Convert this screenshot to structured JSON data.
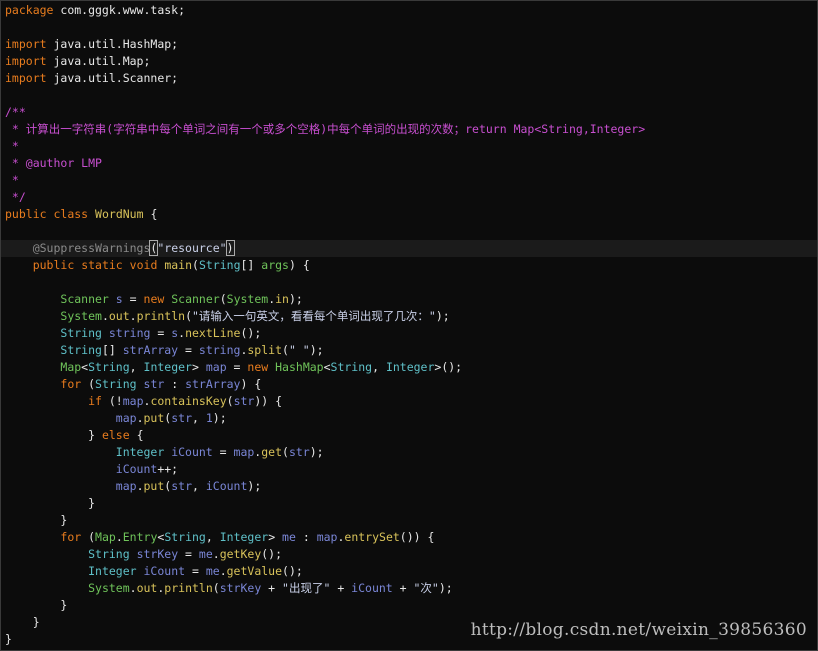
{
  "code": {
    "l01": [
      "package",
      " com.gggk.www.task;"
    ],
    "l03": [
      "import",
      " java.util.HashMap;"
    ],
    "l04": [
      "import",
      " java.util.Map;"
    ],
    "l05": [
      "import",
      " java.util.Scanner;"
    ],
    "l07": "/**",
    "l08": " * 计算出一字符串(字符串中每个单词之间有一个或多个空格)中每个单词的出现的次数；return Map<String,Integer>",
    "l09": " *",
    "l10": [
      " * ",
      "@author",
      " LMP"
    ],
    "l11": " *",
    "l12": " */",
    "l13": [
      "public",
      " ",
      "class",
      " ",
      "WordNum",
      " {"
    ],
    "l15": [
      "    ",
      "@SuppressWarnings",
      "(",
      "\"resource\"",
      ")"
    ],
    "l16": [
      "    ",
      "public",
      " ",
      "static",
      " ",
      "void",
      " ",
      "main",
      "(",
      "String",
      "[] ",
      "args",
      ") {"
    ],
    "l18": [
      "        ",
      "Scanner",
      " ",
      "s",
      " = ",
      "new",
      " ",
      "Scanner",
      "(",
      "System",
      ".",
      "in",
      ");"
    ],
    "l19": [
      "        ",
      "System",
      ".",
      "out",
      ".",
      "println",
      "(",
      "\"请输入一句英文，看看每个单词出现了几次：\"",
      ");"
    ],
    "l20": [
      "        ",
      "String",
      " ",
      "string",
      " = ",
      "s",
      ".",
      "nextLine",
      "();"
    ],
    "l21": [
      "        ",
      "String",
      "[] ",
      "strArray",
      " = ",
      "string",
      ".",
      "split",
      "(",
      "\" \"",
      ");"
    ],
    "l22": [
      "        ",
      "Map",
      "<",
      "String",
      ", ",
      "Integer",
      "> ",
      "map",
      " = ",
      "new",
      " ",
      "HashMap",
      "<",
      "String",
      ", ",
      "Integer",
      ">();"
    ],
    "l23": [
      "        ",
      "for",
      " (",
      "String",
      " ",
      "str",
      " : ",
      "strArray",
      ") {"
    ],
    "l24": [
      "            ",
      "if",
      " (!",
      "map",
      ".",
      "containsKey",
      "(",
      "str",
      ")) {"
    ],
    "l25": [
      "                ",
      "map",
      ".",
      "put",
      "(",
      "str",
      ", ",
      "1",
      ");"
    ],
    "l26": [
      "            ",
      "} ",
      "else",
      " {"
    ],
    "l27": [
      "                ",
      "Integer",
      " ",
      "iCount",
      " = ",
      "map",
      ".",
      "get",
      "(",
      "str",
      ");"
    ],
    "l28": [
      "                ",
      "iCount",
      "++;"
    ],
    "l29": [
      "                ",
      "map",
      ".",
      "put",
      "(",
      "str",
      ", ",
      "iCount",
      ");"
    ],
    "l30": "            }",
    "l31": "        }",
    "l32": [
      "        ",
      "for",
      " (",
      "Map",
      ".",
      "Entry",
      "<",
      "String",
      ", ",
      "Integer",
      "> ",
      "me",
      " : ",
      "map",
      ".",
      "entrySet",
      "()) {"
    ],
    "l33": [
      "            ",
      "String",
      " ",
      "strKey",
      " = ",
      "me",
      ".",
      "getKey",
      "();"
    ],
    "l34": [
      "            ",
      "Integer",
      " ",
      "iCount",
      " = ",
      "me",
      ".",
      "getValue",
      "();"
    ],
    "l35": [
      "            ",
      "System",
      ".",
      "out",
      ".",
      "println",
      "(",
      "strKey",
      " + ",
      "\"出现了\"",
      " + ",
      "iCount",
      " + ",
      "\"次\"",
      ");"
    ],
    "l36": "        }",
    "l37": "    }",
    "l38": "}"
  },
  "watermark": "http://blog.csdn.net/weixin_39856360",
  "colors": {
    "background": "#0c0c0c",
    "keyword": "#e87c1e",
    "type": "#6fc35a",
    "builtin_type": "#5fc0c8",
    "variable": "#7a86d6",
    "method": "#d8c25a",
    "comment": "#c84fd0"
  }
}
